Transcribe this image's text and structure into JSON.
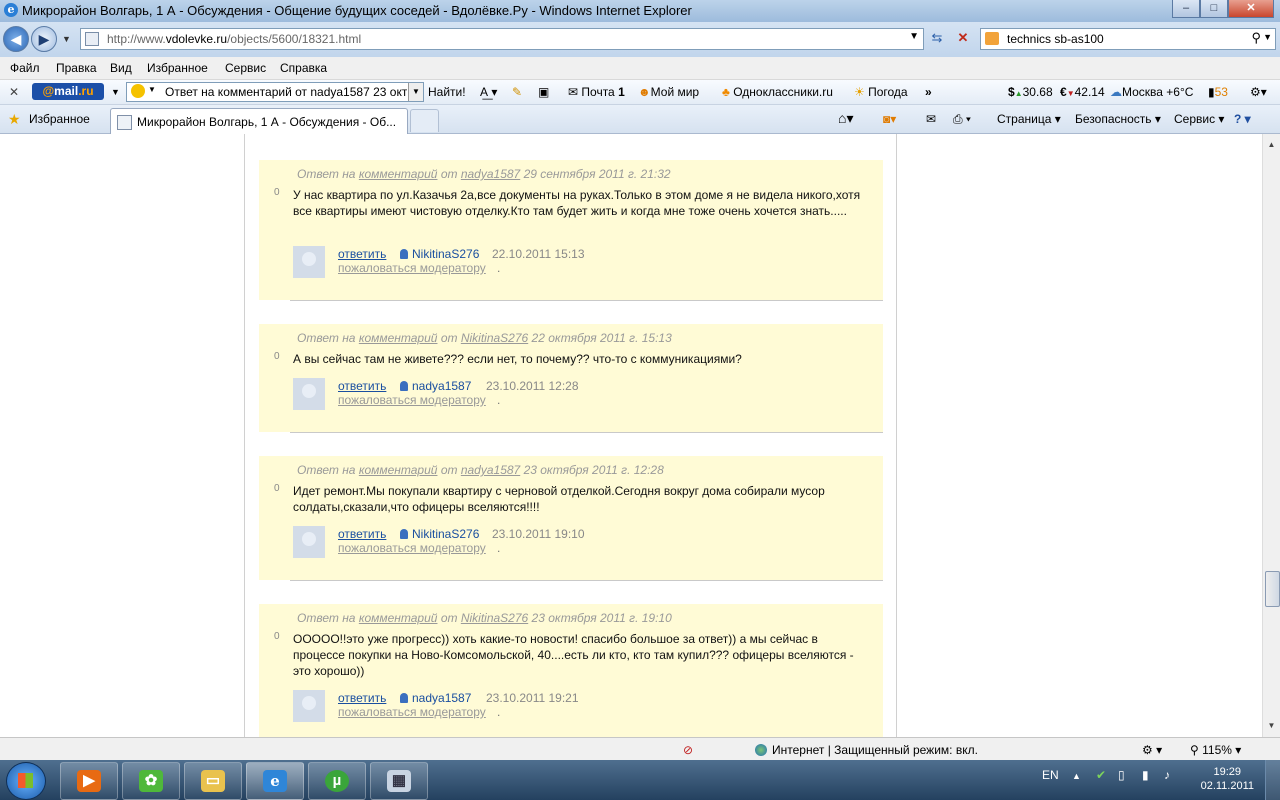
{
  "window": {
    "title": "Микрорайон Волгарь, 1 А - Обсуждения - Общение будущих соседей - Вдолёвке.Ру - Windows Internet Explorer",
    "buttons": {
      "min": "–",
      "max": "□",
      "close": "✕"
    }
  },
  "address": {
    "url_prefix": "http://www.",
    "url_domain": "vdolevke.ru",
    "url_path": "/objects/5600/18321.html"
  },
  "search": {
    "value": "technics sb-as100"
  },
  "menu": [
    "Файл",
    "Правка",
    "Вид",
    "Избранное",
    "Сервис",
    "Справка"
  ],
  "mailbar": {
    "logo_prefix": "@",
    "logo_main": "mail",
    "logo_suffix": ".ru",
    "search_text": "Ответ на комментарий от nadya1587 23 октя",
    "find_label": "Найти!",
    "mail_label": "Почта",
    "mail_count": "1",
    "world_label": "Мой мир",
    "ok_label": "Одноклассники.ru",
    "weather_label": "Погода",
    "more": "»",
    "usd": "30.68",
    "eur": "42.14",
    "city_weather": "Москва +6°C",
    "badge_count": "53"
  },
  "favbar": {
    "favorites_label": "Избранное",
    "tab_title": "Микрорайон Волгарь, 1 А - Обсуждения - Об...",
    "page_label": "Страница",
    "safety_label": "Безопасность",
    "tools_label": "Сервис",
    "help_label": "?"
  },
  "comments": [
    {
      "meta_prefix": "Ответ на",
      "meta_link": "комментарий",
      "meta_from": "от",
      "meta_author": "nadya1587",
      "meta_date": "29 сентября 2011 г. 21:32",
      "vote": "0",
      "body": "У нас квартира по ул.Казачья 2а,все документы на руках.Только в этом доме я не видела никого,хотя все квартиры имеют чистовую отделку.Кто там будет жить и когда мне тоже очень хочется знать.....",
      "reply": "ответить",
      "user": "NikitinaS276",
      "date": "22.10.2011 15:13",
      "report": "пожаловаться модератору",
      "dot": "."
    },
    {
      "meta_prefix": "Ответ на",
      "meta_link": "комментарий",
      "meta_from": "от",
      "meta_author": "NikitinaS276",
      "meta_date": "22 октября 2011 г. 15:13",
      "vote": "0",
      "body": "А вы сейчас там не живете??? если нет, то почему?? что-то с коммуникациями?",
      "reply": "ответить",
      "user": "nadya1587",
      "date": "23.10.2011 12:28",
      "report": "пожаловаться модератору",
      "dot": "."
    },
    {
      "meta_prefix": "Ответ на",
      "meta_link": "комментарий",
      "meta_from": "от",
      "meta_author": "nadya1587",
      "meta_date": "23 октября 2011 г. 12:28",
      "vote": "0",
      "body": "Идет ремонт.Мы покупали квартиру с черновой отделкой.Сегодня вокруг дома собирали мусор солдаты,сказали,что офицеры вселяются!!!!",
      "reply": "ответить",
      "user": "NikitinaS276",
      "date": "23.10.2011 19:10",
      "report": "пожаловаться модератору",
      "dot": "."
    },
    {
      "meta_prefix": "Ответ на",
      "meta_link": "комментарий",
      "meta_from": "от",
      "meta_author": "NikitinaS276",
      "meta_date": "23 октября 2011 г. 19:10",
      "vote": "0",
      "body": "ООООО!!это уже прогресс)) хоть какие-то новости! спасибо большое за ответ)) а мы сейчас в процессе покупки на Ново-Комсомольской, 40....есть ли кто, кто там купил??? офицеры вселяются - это хорошо))",
      "reply": "ответить",
      "user": "nadya1587",
      "date": "23.10.2011 19:21",
      "report": "пожаловаться модератору",
      "dot": "."
    }
  ],
  "status": {
    "zone": "Интернет | Защищенный режим: вкл.",
    "zoom": "115%"
  },
  "taskbar": {
    "lang": "EN",
    "time": "19:29",
    "date": "02.11.2011"
  },
  "colors": {
    "comment_bg": "#fffbd6",
    "link": "#1a4fa0",
    "muted": "#999999"
  }
}
